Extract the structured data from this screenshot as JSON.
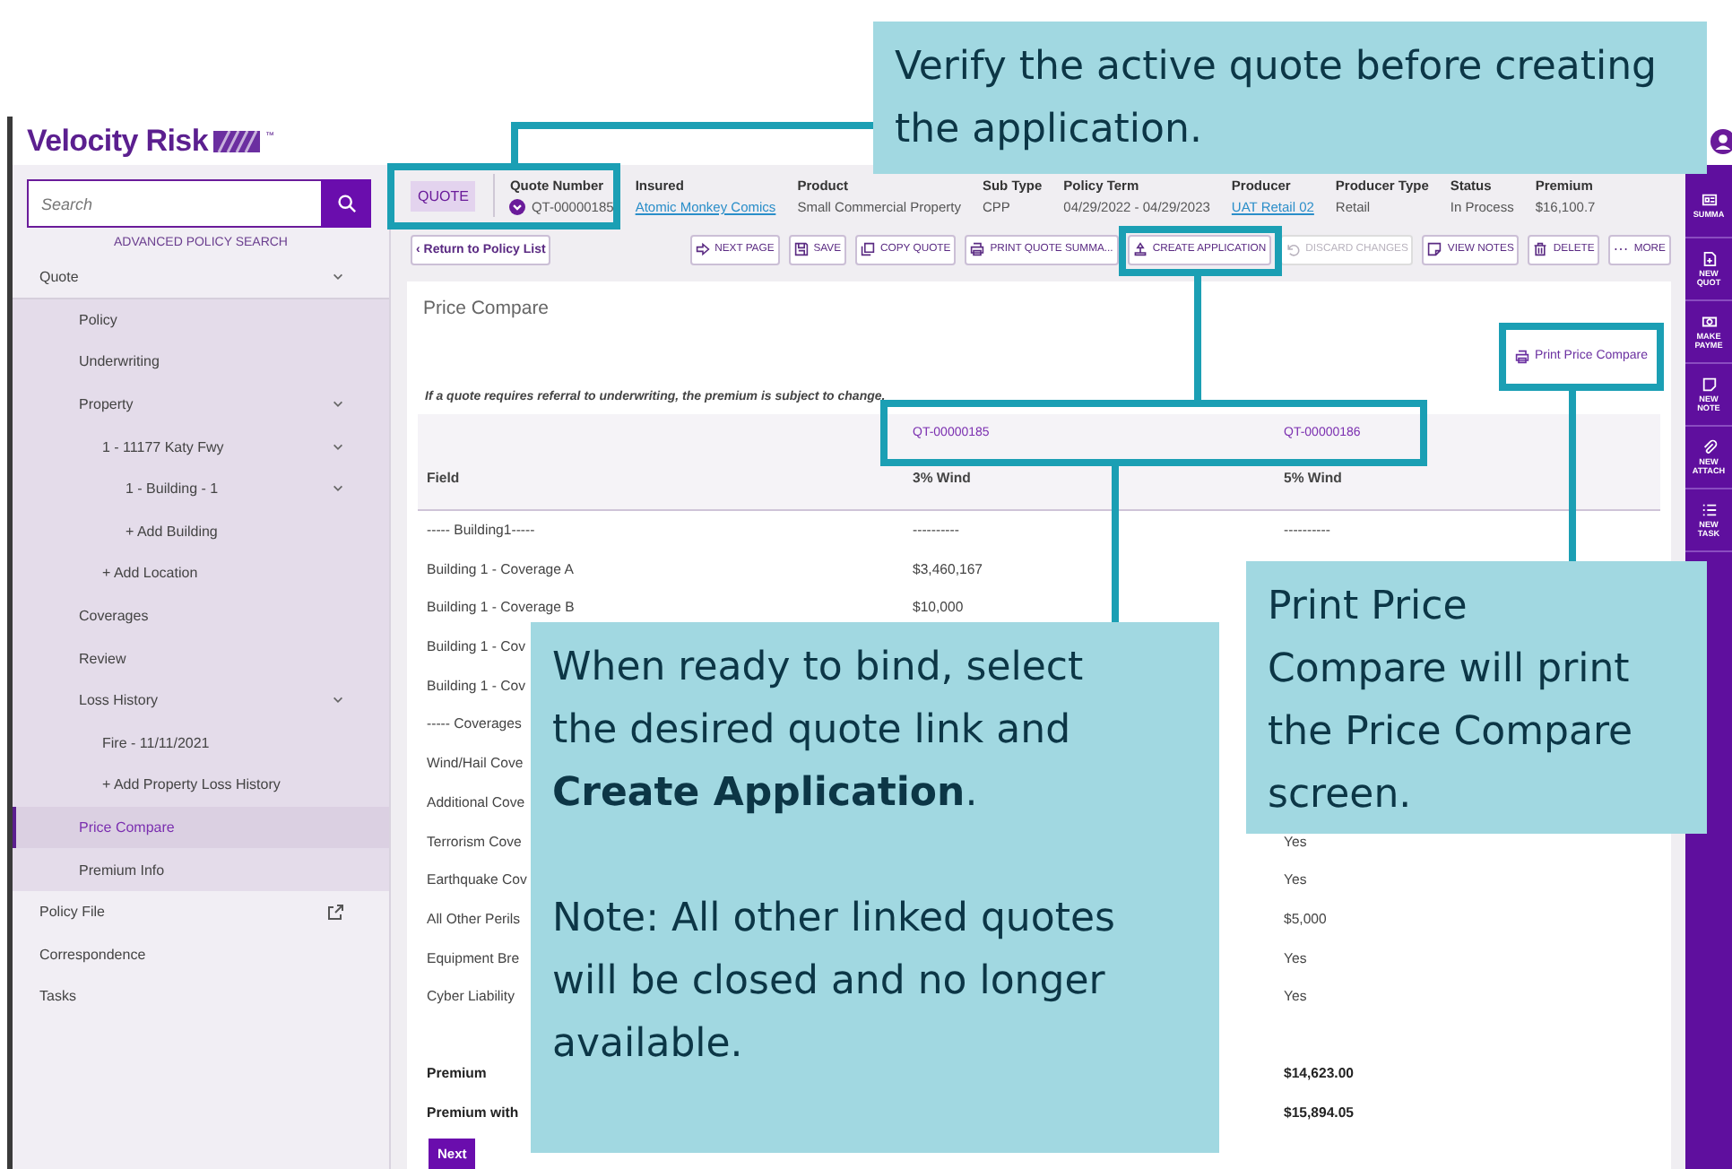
{
  "app": {
    "logo": "Velocity Risk",
    "logo_mark": "™"
  },
  "sidebar": {
    "search": {
      "placeholder": "Search"
    },
    "advanced_search": "ADVANCED POLICY SEARCH",
    "items": [
      {
        "label": "Quote",
        "selected": false,
        "expanded": true,
        "children": [
          {
            "label": "Policy",
            "selected": false
          },
          {
            "label": "Underwriting",
            "selected": false
          },
          {
            "label": "Property",
            "selected": false,
            "expanded": true,
            "children": [
              {
                "label": "1 - 11177 Katy Fwy",
                "selected": false,
                "expanded": true,
                "children": [
                  {
                    "label": "1 - Building - 1",
                    "selected": false,
                    "expanded": true
                  },
                  {
                    "label": "+ Add Building",
                    "selected": false
                  }
                ]
              },
              {
                "label": "+ Add Location",
                "selected": false
              }
            ]
          },
          {
            "label": "Coverages",
            "selected": false
          },
          {
            "label": "Review",
            "selected": false
          },
          {
            "label": "Loss History",
            "selected": false,
            "expanded": true,
            "children": [
              {
                "label": "Fire - 11/11/2021",
                "selected": false
              },
              {
                "label": "+ Add Property Loss History",
                "selected": false
              }
            ]
          },
          {
            "label": "Price Compare",
            "selected": true
          },
          {
            "label": "Premium Info",
            "selected": false
          }
        ]
      },
      {
        "label": "Policy File",
        "selected": false,
        "external": true
      },
      {
        "label": "Correspondence",
        "selected": false
      },
      {
        "label": "Tasks",
        "selected": false
      }
    ]
  },
  "quote_header": {
    "badge": "QUOTE",
    "fields": [
      {
        "label": "Quote Number",
        "value": "QT-00000185",
        "link": false
      },
      {
        "label": "Insured",
        "value": "Atomic Monkey Comics",
        "link": true
      },
      {
        "label": "Product",
        "value": "Small Commercial Property",
        "link": false
      },
      {
        "label": "Sub Type",
        "value": "CPP",
        "link": false
      },
      {
        "label": "Policy Term",
        "value": "04/29/2022 - 04/29/2023",
        "link": false
      },
      {
        "label": "Producer",
        "value": "UAT Retail 02",
        "link": true
      },
      {
        "label": "Producer Type",
        "value": "Retail",
        "link": false
      },
      {
        "label": "Status",
        "value": "In Process",
        "link": false
      },
      {
        "label": "Premium",
        "value": "$16,100.7",
        "link": false
      }
    ]
  },
  "toolbar": {
    "back": "‹ Return to Policy List",
    "buttons": [
      {
        "label": "NEXT PAGE",
        "disabled": false
      },
      {
        "label": "SAVE",
        "disabled": false
      },
      {
        "label": "COPY QUOTE",
        "disabled": false
      },
      {
        "label": "PRINT QUOTE SUMMA...",
        "disabled": false
      },
      {
        "label": "CREATE APPLICATION",
        "disabled": false
      },
      {
        "label": "DISCARD CHANGES",
        "disabled": true
      },
      {
        "label": "VIEW NOTES",
        "disabled": false
      },
      {
        "label": "DELETE",
        "disabled": false
      },
      {
        "label": "MORE",
        "disabled": false
      }
    ]
  },
  "page": {
    "title": "Price Compare",
    "print_link": "Print Price Compare",
    "notice": "If a quote requires referral to underwriting, the premium is subject to change.",
    "quote_links": [
      "QT-00000185",
      "QT-00000186"
    ],
    "columns": [
      "Field",
      "3% Wind",
      "5% Wind"
    ],
    "rows": [
      {
        "field": "----- Building1-----",
        "quote_1": "----------",
        "quote_2": "----------"
      },
      {
        "field": "Building 1 - Coverage A",
        "quote_1": "$3,460,167"
      },
      {
        "field": "Building 1 - Coverage B",
        "quote_1": "$10,000"
      },
      {
        "field": "Building 1 - Cov"
      },
      {
        "field": "Building 1 - Cov"
      },
      {
        "field": "----- Coverages"
      },
      {
        "field": "Wind/Hail Cove"
      },
      {
        "field": "Additional Cove"
      },
      {
        "field": "Terrorism Cove",
        "quote_2": "Yes"
      },
      {
        "field": "Earthquake Cov",
        "quote_2": "Yes"
      },
      {
        "field": "All Other Perils",
        "quote_2": "$5,000"
      },
      {
        "field": "Equipment Bre",
        "quote_2": "Yes"
      },
      {
        "field": "Cyber Liability",
        "quote_2": "Yes"
      }
    ],
    "totals": [
      {
        "field": "Premium",
        "quote_2": "$14,623.00"
      },
      {
        "field": "Premium with",
        "quote_2": "$15,894.05"
      }
    ],
    "next_button": "Next"
  },
  "right_rail": [
    {
      "label": "SUMMA"
    },
    {
      "label": "NEW QUOT"
    },
    {
      "label": "MAKE PAYME"
    },
    {
      "label": "NEW NOTE"
    },
    {
      "label": "NEW ATTACH"
    },
    {
      "label": "NEW TASK"
    }
  ],
  "callouts": [
    {
      "paragraphs": [
        "Verify the active quote before creating the application."
      ]
    },
    {
      "paragraphs": [
        "When ready to bind, select the desired quote link and **Create Application**.",
        "Note: All other linked quotes will be closed and no longer available."
      ]
    },
    {
      "paragraphs": [
        "Print Price Compare will print the Price Compare screen."
      ]
    }
  ]
}
